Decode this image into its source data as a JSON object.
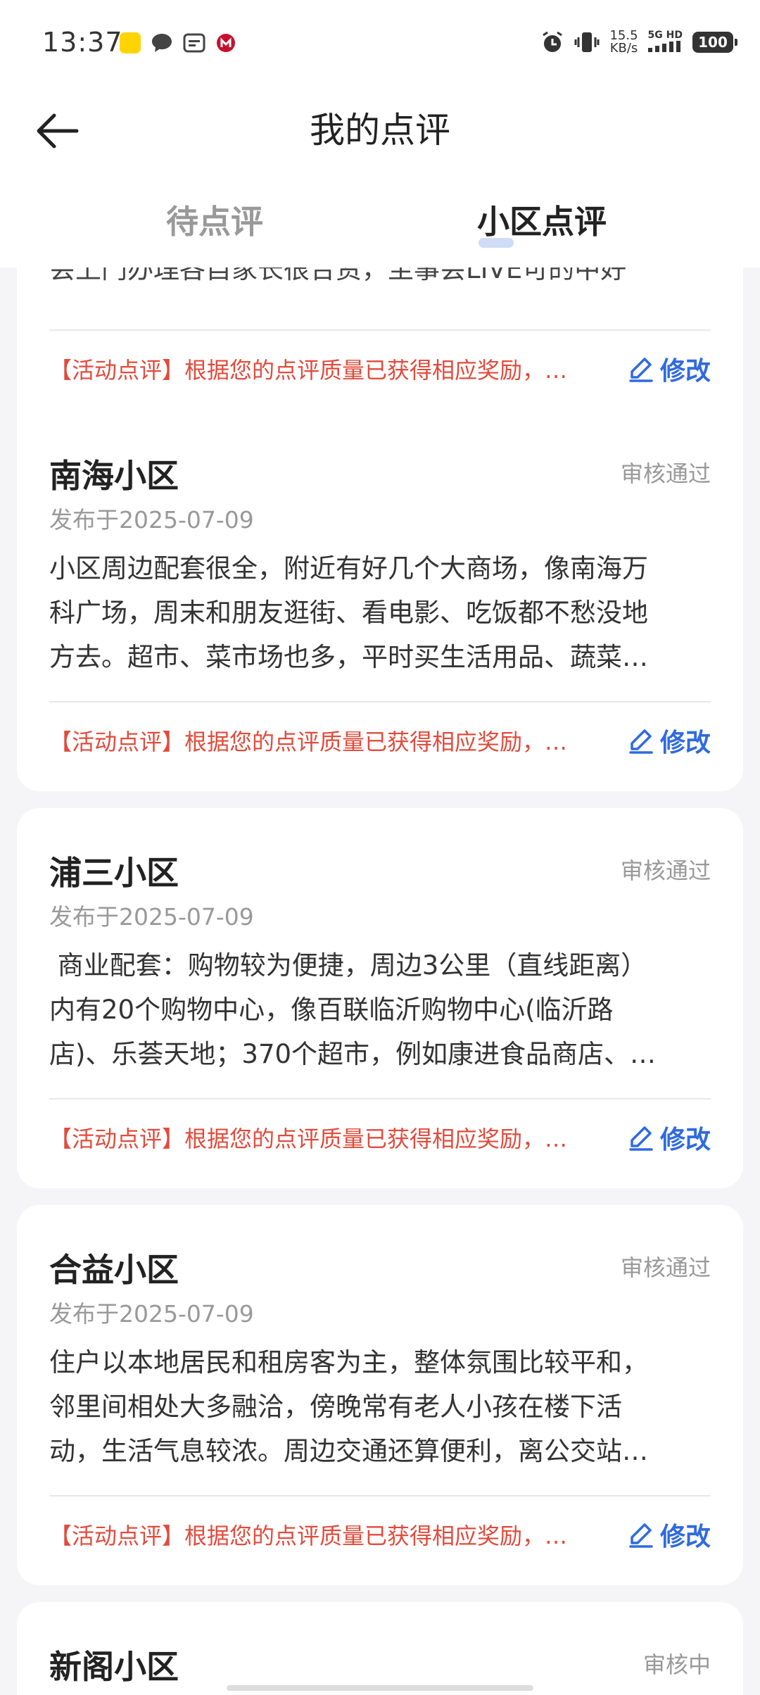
{
  "status_bar": {
    "time": "13:37",
    "speed_value": "15.5",
    "speed_unit": "KB/s",
    "network_label": "5G HD",
    "battery": "100"
  },
  "header": {
    "title": "我的点评",
    "tabs": [
      {
        "label": "待点评",
        "active": false
      },
      {
        "label": "小区点评",
        "active": true
      }
    ]
  },
  "partial_card": {
    "body_tail": "会上门办理各自家长很合资，至事会LIVE可的中好",
    "reward_text": "【活动点评】根据您的点评质量已获得相应奖励，…",
    "edit_label": "修改"
  },
  "reviews": [
    {
      "name": "南海小区",
      "status": "审核通过",
      "date": "发布于2025-07-09",
      "lines": [
        "小区周边配套很全，附近有好几个大商场，像南海万",
        "科广场，周末和朋友逛街、看电影、吃饭都不愁没地",
        "方去。超市、菜市场也多，平时买生活用品、蔬菜…"
      ],
      "reward_text": "【活动点评】根据您的点评质量已获得相应奖励，…",
      "edit_label": "修改"
    },
    {
      "name": "浦三小区",
      "status": "审核通过",
      "date": "发布于2025-07-09",
      "lines": [
        " 商业配套：购物较为便捷，周边3公里（直线距离）",
        "内有20个购物中心，像百联临沂购物中心(临沂路",
        "店)、乐荟天地；370个超市，例如康进食品商店、…"
      ],
      "reward_text": "【活动点评】根据您的点评质量已获得相应奖励，…",
      "edit_label": "修改"
    },
    {
      "name": "合益小区",
      "status": "审核通过",
      "date": "发布于2025-07-09",
      "lines": [
        "住户以本地居民和租房客为主，整体氛围比较平和，",
        "邻里间相处大多融洽，傍晚常有老人小孩在楼下活",
        "动，生活气息较浓。周边交通还算便利，离公交站…"
      ],
      "reward_text": "【活动点评】根据您的点评质量已获得相应奖励，…",
      "edit_label": "修改"
    },
    {
      "name": "新阁小区",
      "status": "审核中"
    }
  ],
  "colors": {
    "accent": "#2f6ae0",
    "reward": "#e14b3c",
    "muted": "#999999"
  }
}
